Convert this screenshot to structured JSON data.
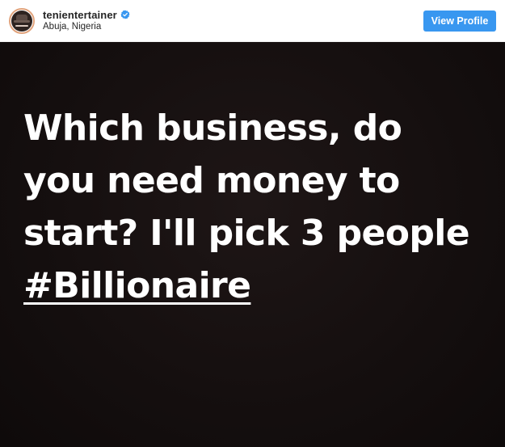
{
  "header": {
    "username": "tenientertainer",
    "location": "Abuja, Nigeria",
    "view_profile_label": "View Profile",
    "verified": true,
    "avatar_icon": "profile-avatar",
    "accent_color": "#3897f0"
  },
  "post": {
    "lines": [
      "Which business, do",
      "you need money to",
      "start? I'll pick 3 people"
    ],
    "hashtag": "#Billionaire",
    "background_color": "#150f0f",
    "text_color": "#ffffff"
  }
}
